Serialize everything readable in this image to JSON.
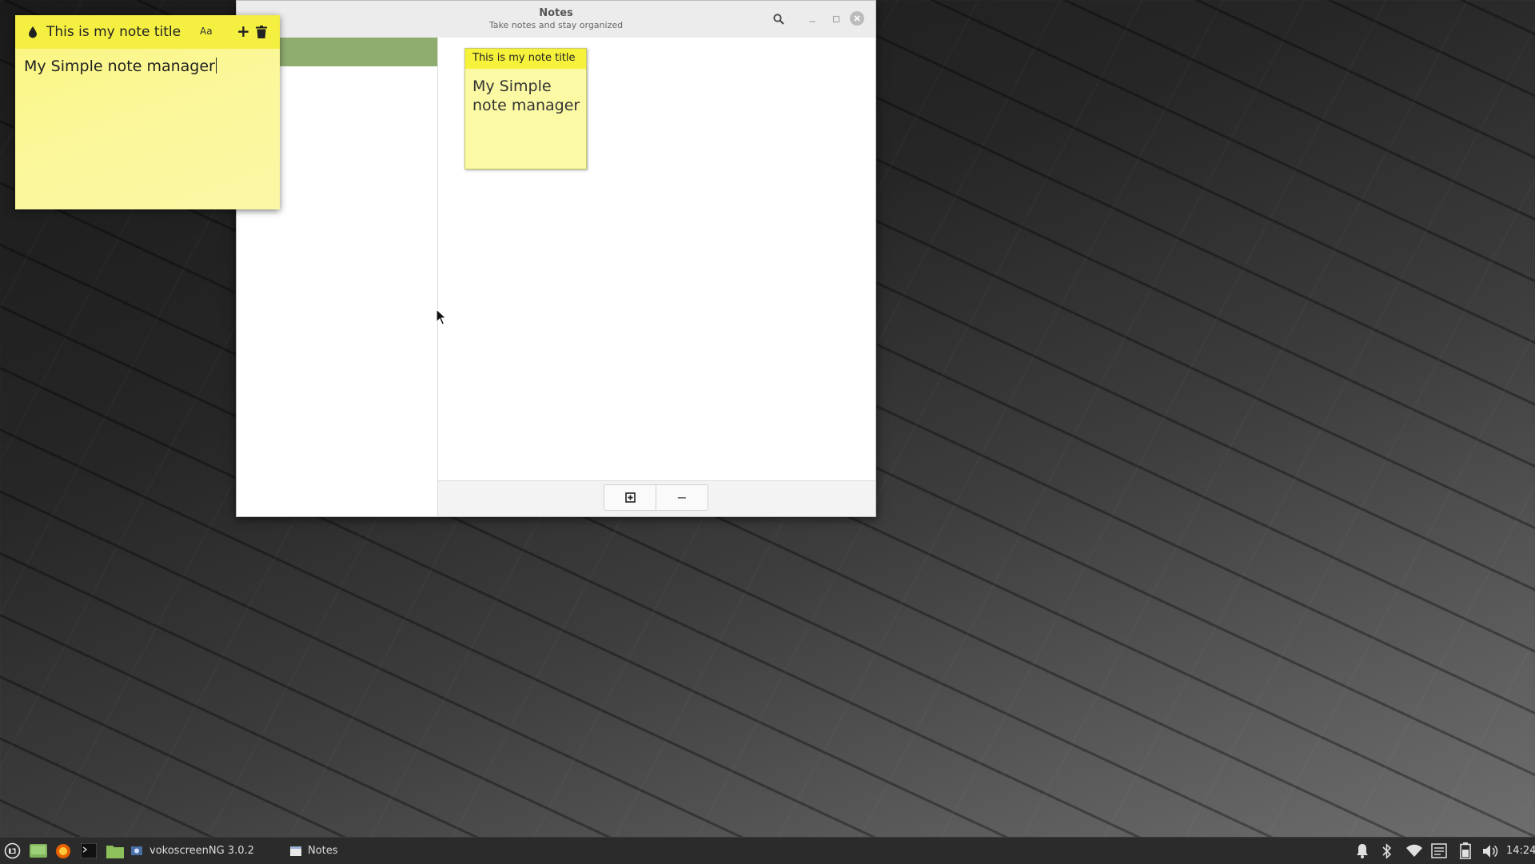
{
  "notes_window": {
    "title": "Notes",
    "subtitle": "Take notes and stay organized",
    "note_cards": [
      {
        "title": "This is my note title",
        "body": "My Simple note manager"
      }
    ],
    "add_label": "⊞",
    "remove_label": "−"
  },
  "sticky_note": {
    "title": "This is my note title",
    "font_label": "Aa",
    "add_label": "+",
    "body": "My Simple note manager"
  },
  "taskbar": {
    "tasks": [
      {
        "label": "vokoscreenNG 3.0.2"
      },
      {
        "label": "Notes"
      }
    ],
    "clock": "14:24"
  },
  "colors": {
    "sticky_header": "#f5ef42",
    "sticky_body": "#fbf79a",
    "sidebar_selected": "#8fad6f",
    "taskbar_bg": "#2b2b2b"
  }
}
